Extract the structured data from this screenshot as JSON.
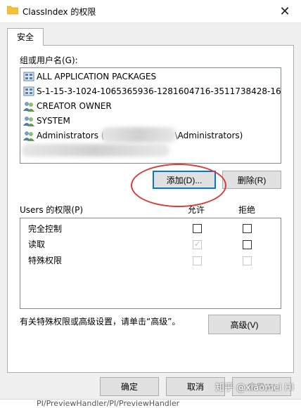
{
  "window": {
    "title": "ClassIndex 的权限",
    "close_glyph": "✕"
  },
  "tabs": [
    {
      "label": "安全"
    }
  ],
  "groups": {
    "label": "组或用户名(G):",
    "items": [
      {
        "label": "ALL APPLICATION PACKAGES",
        "icon": "app-packages-icon"
      },
      {
        "label": "S-1-15-3-1024-1065365936-1281604716-3511738428-165...",
        "icon": "sid-icon"
      },
      {
        "label": "CREATOR OWNER",
        "icon": "users-icon"
      },
      {
        "label": "SYSTEM",
        "icon": "users-icon"
      },
      {
        "label": "Administrators (",
        "suffix": "\\Administrators)",
        "icon": "users-icon"
      }
    ]
  },
  "buttons": {
    "add": "添加(D)...",
    "remove": "删除(R)",
    "advanced": "高级(V)",
    "ok": "确定",
    "cancel": "取消",
    "apply": "应用(A)"
  },
  "permissions": {
    "label": "Users 的权限(P)",
    "allow_header": "允许",
    "deny_header": "拒绝",
    "rows": [
      {
        "name": "完全控制",
        "allow": false,
        "deny": false,
        "allow_disabled": false,
        "deny_disabled": false
      },
      {
        "name": "读取",
        "allow": true,
        "deny": false,
        "allow_disabled": true,
        "deny_disabled": false
      },
      {
        "name": "特殊权限",
        "allow": false,
        "deny": false,
        "allow_disabled": true,
        "deny_disabled": true
      }
    ]
  },
  "advanced_note": "有关特殊权限或高级设置，请单击“高级”。",
  "watermark": "知乎 @xiaomei Hi",
  "background_text": "PI/PreviewHandler/PI/PreviewHandler",
  "colors": {
    "focus_border": "#0078d7",
    "annotation_red": "#d83b3b"
  }
}
